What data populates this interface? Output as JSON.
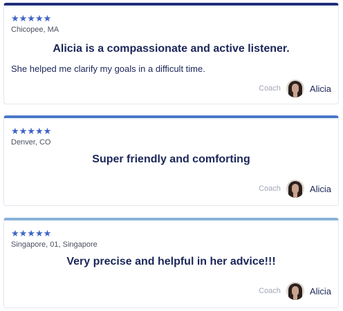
{
  "reviews": [
    {
      "stars": "★★★★★",
      "location": "Chicopee, MA",
      "headline": "Alicia is a compassionate and active listener.",
      "body": "She helped me clarify my goals in a difficult time.",
      "coach_label": "Coach",
      "coach_name": "Alicia",
      "rating": 5
    },
    {
      "stars": "★★★★★",
      "location": "Denver, CO",
      "headline": "Super friendly and comforting",
      "body": "",
      "coach_label": "Coach",
      "coach_name": "Alicia",
      "rating": 5
    },
    {
      "stars": "★★★★★",
      "location": "Singapore, 01, Singapore",
      "headline": "Very precise and helpful in her advice!!!",
      "body": "",
      "coach_label": "Coach",
      "coach_name": "Alicia",
      "rating": 5
    }
  ],
  "colors": {
    "stars": "#3f63c8",
    "headline": "#1b2659",
    "card1_top": "#1f2f7a",
    "card2_top": "#4a77c9",
    "card3_top": "#8ab2d8"
  }
}
